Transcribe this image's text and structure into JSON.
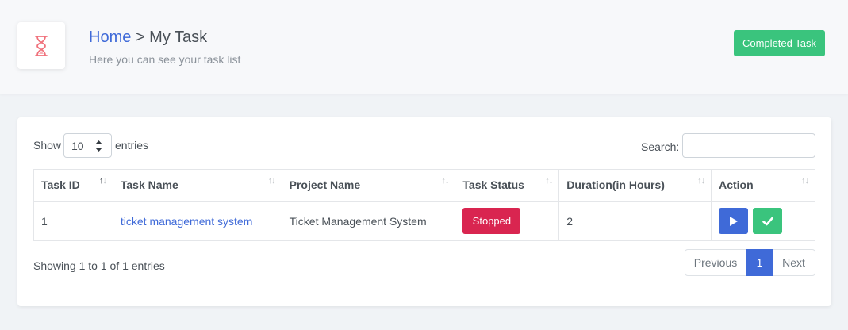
{
  "header": {
    "breadcrumb_home": "Home",
    "breadcrumb_sep": " > ",
    "breadcrumb_current": "My Task",
    "subtitle": "Here you can see your task list",
    "icon": "hourglass-icon",
    "completed_button": "Completed Task"
  },
  "table_controls": {
    "show_label": "Show",
    "entries_value": "10",
    "entries_label": "entries",
    "search_label": "Search:",
    "search_value": ""
  },
  "columns": [
    "Task ID",
    "Task Name",
    "Project Name",
    "Task Status",
    "Duration(in Hours)",
    "Action"
  ],
  "rows": [
    {
      "task_id": "1",
      "task_name": "ticket management system",
      "project_name": "Ticket Management System",
      "task_status": "Stopped",
      "duration": "2",
      "actions": [
        "play-icon",
        "check-icon"
      ]
    }
  ],
  "footer": {
    "showing": "Showing 1 to 1 of 1 entries",
    "previous": "Previous",
    "current_page": "1",
    "next": "Next"
  },
  "colors": {
    "primary": "#3f6ad8",
    "success": "#3ac47d",
    "danger": "#d92550"
  }
}
